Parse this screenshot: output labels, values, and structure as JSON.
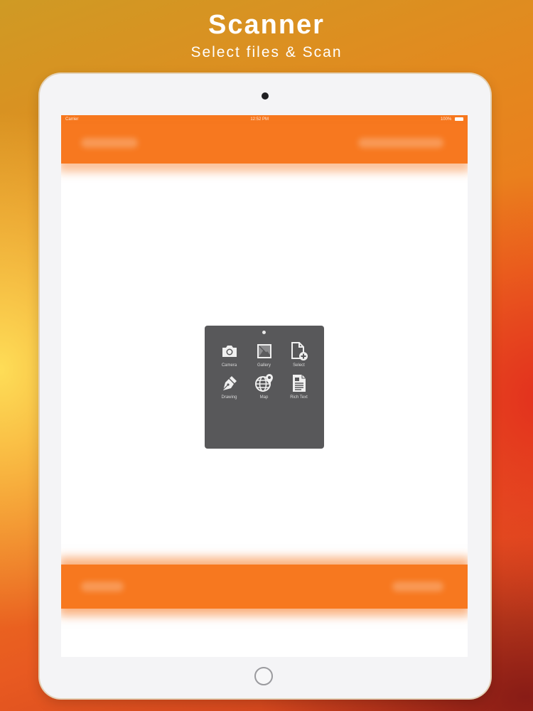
{
  "promo": {
    "title": "Scanner",
    "subtitle": "Select files & Scan"
  },
  "status_bar": {
    "carrier": "Carrier",
    "time": "12:52 PM",
    "battery": "100%"
  },
  "popover": {
    "items": [
      {
        "label": "Camera",
        "icon": "camera-icon"
      },
      {
        "label": "Gallery",
        "icon": "gallery-icon"
      },
      {
        "label": "Select",
        "icon": "add-file-icon"
      },
      {
        "label": "Drawing",
        "icon": "pen-icon"
      },
      {
        "label": "Map",
        "icon": "map-globe-icon"
      },
      {
        "label": "Rich Text",
        "icon": "rich-text-icon"
      }
    ]
  },
  "colors": {
    "accent": "#f7781f",
    "popover_bg": "#58585a",
    "icon": "#f0f0f0"
  }
}
